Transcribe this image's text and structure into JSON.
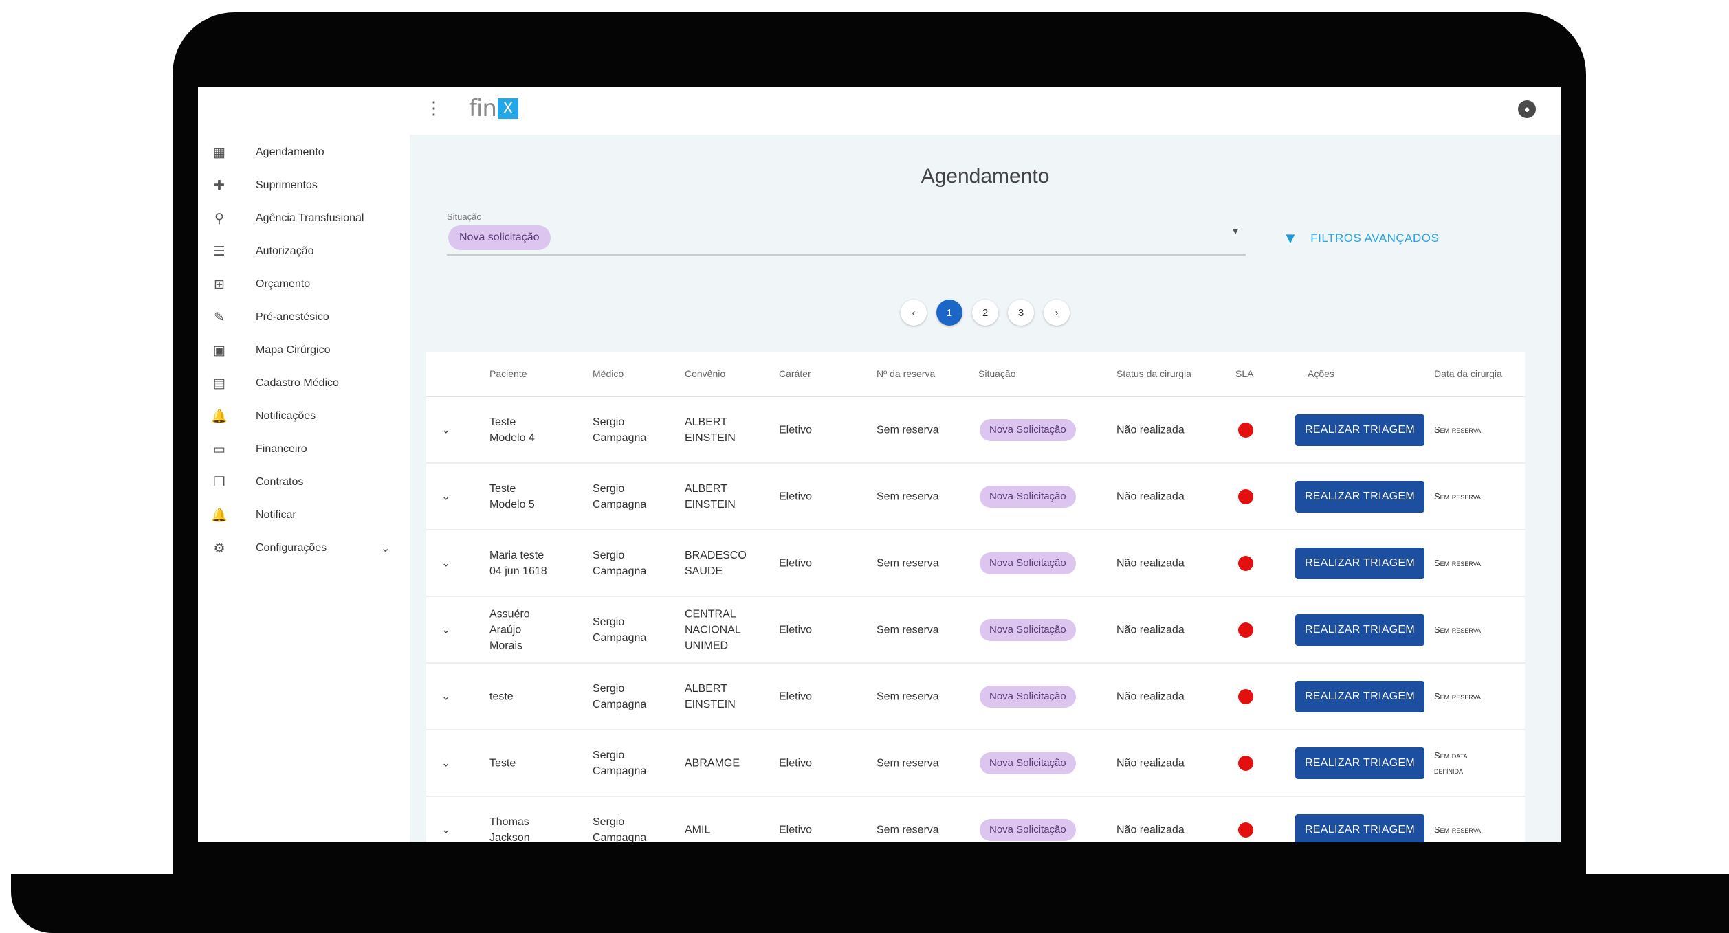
{
  "header": {
    "logo_text": "fin",
    "logo_mark": "X"
  },
  "sidebar": {
    "items": [
      {
        "label": "Agendamento",
        "icon": "book-icon",
        "glyph": "▦"
      },
      {
        "label": "Suprimentos",
        "icon": "medkit-icon",
        "glyph": "✚"
      },
      {
        "label": "Agência Transfusional",
        "icon": "blood-bag-icon",
        "glyph": "⚲"
      },
      {
        "label": "Autorização",
        "icon": "checklist-icon",
        "glyph": "☰"
      },
      {
        "label": "Orçamento",
        "icon": "calculator-icon",
        "glyph": "⊞"
      },
      {
        "label": "Pré-anestésico",
        "icon": "syringe-icon",
        "glyph": "✎"
      },
      {
        "label": "Mapa Cirúrgico",
        "icon": "clipboard-pulse-icon",
        "glyph": "▣"
      },
      {
        "label": "Cadastro Médico",
        "icon": "clipboard-icon",
        "glyph": "▤"
      },
      {
        "label": "Notificações",
        "icon": "bell-icon",
        "glyph": "🔔"
      },
      {
        "label": "Financeiro",
        "icon": "money-icon",
        "glyph": "▭"
      },
      {
        "label": "Contratos",
        "icon": "documents-icon",
        "glyph": "❐"
      },
      {
        "label": "Notificar",
        "icon": "bell-ring-icon",
        "glyph": "🔔"
      },
      {
        "label": "Configurações",
        "icon": "cogs-icon",
        "glyph": "⚙"
      }
    ]
  },
  "main": {
    "title": "Agendamento",
    "filter": {
      "label": "Situação",
      "chip": "Nova solicitação",
      "advanced_filters": "FILTROS AVANÇADOS"
    },
    "pagination": {
      "prev": "‹",
      "pages": [
        "1",
        "2",
        "3"
      ],
      "active_page": "1",
      "next": "›"
    },
    "table": {
      "columns": [
        "Paciente",
        "Médico",
        "Convênio",
        "Caráter",
        "Nº da reserva",
        "Situação",
        "Status da cirurgia",
        "SLA",
        "Ações",
        "Data da cirurgia"
      ],
      "rows": [
        {
          "paciente": [
            "Teste",
            "Modelo 4"
          ],
          "medico": [
            "Sergio",
            "Campagna"
          ],
          "convenio": [
            "ALBERT",
            "EINSTEIN"
          ],
          "carater": "Eletivo",
          "reserva": "Sem reserva",
          "situacao": "Nova Solicitação",
          "status": "Não realizada",
          "sla_color": "#e41010",
          "acao": "REALIZAR TRIAGEM",
          "data": [
            "Sem reserva"
          ]
        },
        {
          "paciente": [
            "Teste",
            "Modelo 5"
          ],
          "medico": [
            "Sergio",
            "Campagna"
          ],
          "convenio": [
            "ALBERT",
            "EINSTEIN"
          ],
          "carater": "Eletivo",
          "reserva": "Sem reserva",
          "situacao": "Nova Solicitação",
          "status": "Não realizada",
          "sla_color": "#e41010",
          "acao": "REALIZAR TRIAGEM",
          "data": [
            "Sem reserva"
          ]
        },
        {
          "paciente": [
            "Maria teste",
            "04 jun 1618"
          ],
          "medico": [
            "Sergio",
            "Campagna"
          ],
          "convenio": [
            "BRADESCO",
            "SAUDE"
          ],
          "carater": "Eletivo",
          "reserva": "Sem reserva",
          "situacao": "Nova Solicitação",
          "status": "Não realizada",
          "sla_color": "#e41010",
          "acao": "REALIZAR TRIAGEM",
          "data": [
            "Sem reserva"
          ]
        },
        {
          "paciente": [
            "Assuéro",
            "Araújo",
            "Morais"
          ],
          "medico": [
            "Sergio",
            "Campagna"
          ],
          "convenio": [
            "CENTRAL",
            "NACIONAL",
            "UNIMED"
          ],
          "carater": "Eletivo",
          "reserva": "Sem reserva",
          "situacao": "Nova Solicitação",
          "status": "Não realizada",
          "sla_color": "#e41010",
          "acao": "REALIZAR TRIAGEM",
          "data": [
            "Sem reserva"
          ]
        },
        {
          "paciente": [
            "teste"
          ],
          "medico": [
            "Sergio",
            "Campagna"
          ],
          "convenio": [
            "ALBERT",
            "EINSTEIN"
          ],
          "carater": "Eletivo",
          "reserva": "Sem reserva",
          "situacao": "Nova Solicitação",
          "status": "Não realizada",
          "sla_color": "#e41010",
          "acao": "REALIZAR TRIAGEM",
          "data": [
            "Sem reserva"
          ]
        },
        {
          "paciente": [
            "Teste"
          ],
          "medico": [
            "Sergio",
            "Campagna"
          ],
          "convenio": [
            "ABRAMGE"
          ],
          "carater": "Eletivo",
          "reserva": "Sem reserva",
          "situacao": "Nova Solicitação",
          "status": "Não realizada",
          "sla_color": "#e41010",
          "acao": "REALIZAR TRIAGEM",
          "data": [
            "Sem data",
            "definida"
          ]
        },
        {
          "paciente": [
            "Thomas",
            "Jackson"
          ],
          "medico": [
            "Sergio",
            "Campagna"
          ],
          "convenio": [
            "AMIL"
          ],
          "carater": "Eletivo",
          "reserva": "Sem reserva",
          "situacao": "Nova Solicitação",
          "status": "Não realizada",
          "sla_color": "#e41010",
          "acao": "REALIZAR TRIAGEM",
          "data": [
            "Sem reserva"
          ]
        }
      ]
    }
  },
  "colors": {
    "accent": "#1d4fa0",
    "link": "#27a6e1",
    "chip_bg": "#dcc6ef",
    "sla_red": "#e41010"
  }
}
